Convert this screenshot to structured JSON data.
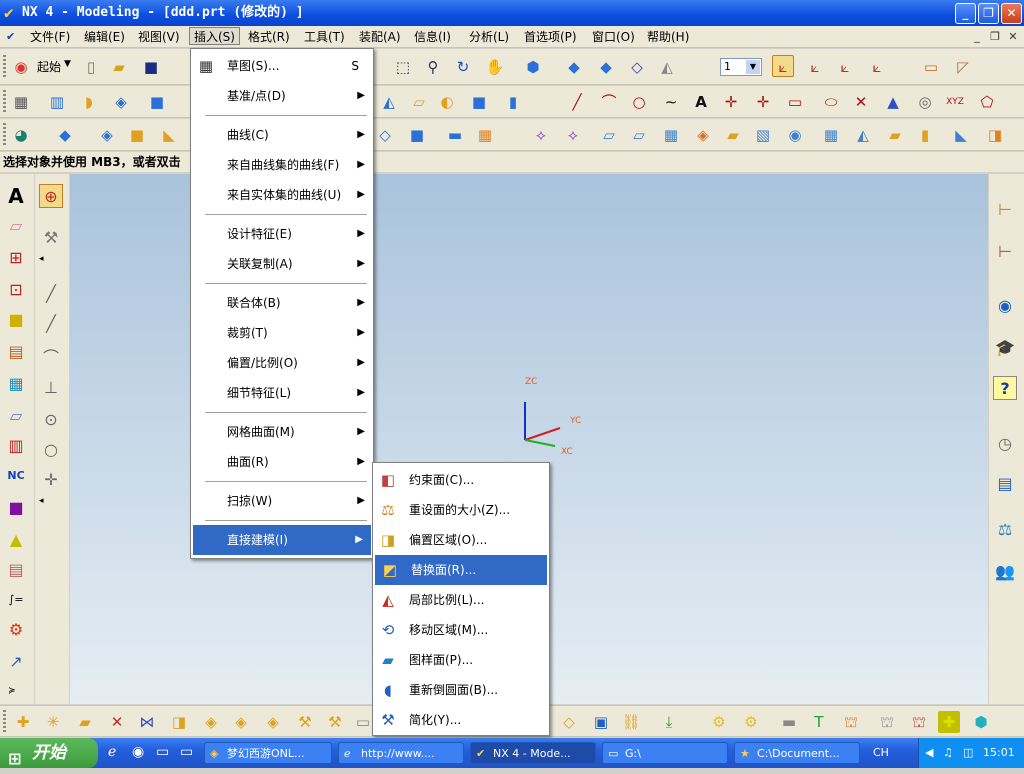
{
  "window": {
    "title": "NX 4 - Modeling - [ddd.prt  (修改的) ]",
    "minimize": "_",
    "restore": "❐",
    "close": "✕"
  },
  "menubar": {
    "items": [
      "文件(F)",
      "编辑(E)",
      "视图(V)",
      "插入(S)",
      "格式(R)",
      "工具(T)",
      "装配(A)",
      "信息(I)",
      "分析(L)",
      "首选项(P)",
      "窗口(O)",
      "帮助(H)"
    ],
    "active": "插入(S)"
  },
  "toolbar": {
    "start_label": "起始",
    "layer_value": "1"
  },
  "status": {
    "prompt": "选择对象并使用 MB3，或者双击"
  },
  "axes": {
    "zc": "ZC",
    "yc": "YC",
    "xc": "XC",
    "colors": {
      "z": "#1030d0",
      "y": "#d02020",
      "x": "#20b020",
      "label": "#e06020"
    }
  },
  "insert_menu": {
    "items": [
      {
        "label": "草图(S)...",
        "shortcut": "S",
        "submenu": false
      },
      {
        "label": "基准/点(D)",
        "submenu": true
      },
      {
        "label": "曲线(C)",
        "submenu": true
      },
      {
        "label": "来自曲线集的曲线(F)",
        "submenu": true
      },
      {
        "label": "来自实体集的曲线(U)",
        "submenu": true
      },
      {
        "label": "设计特征(E)",
        "submenu": true
      },
      {
        "label": "关联复制(A)",
        "submenu": true
      },
      {
        "label": "联合体(B)",
        "submenu": true
      },
      {
        "label": "裁剪(T)",
        "submenu": true
      },
      {
        "label": "偏置/比例(O)",
        "submenu": true
      },
      {
        "label": "细节特征(L)",
        "submenu": true
      },
      {
        "label": "网格曲面(M)",
        "submenu": true
      },
      {
        "label": "曲面(R)",
        "submenu": true
      },
      {
        "label": "扫掠(W)",
        "submenu": true
      },
      {
        "label": "直接建模(I)",
        "submenu": true
      }
    ],
    "highlighted": "直接建模(I)"
  },
  "direct_modeling_menu": {
    "items": [
      "约束面(C)...",
      "重设面的大小(Z)...",
      "偏置区域(O)...",
      "替换面(R)...",
      "局部比例(L)...",
      "移动区域(M)...",
      "图样面(P)...",
      "重新倒圆面(B)...",
      "简化(Y)..."
    ],
    "highlighted": "替换面(R)..."
  },
  "taskbar": {
    "start": "开始",
    "tasks": [
      "梦幻西游ONL...",
      "http://www....",
      "NX 4 - Mode...",
      "G:\\",
      "C:\\Document..."
    ],
    "active_task": "NX 4 - Mode...",
    "lang": "CH",
    "clock": "15:01"
  },
  "colors": {
    "titlebar": "#0b4ee0",
    "highlight": "#3169c6",
    "viewport_top": "#a9c3dc",
    "viewport_bottom": "#e6edf3",
    "taskbar": "#245edc"
  }
}
